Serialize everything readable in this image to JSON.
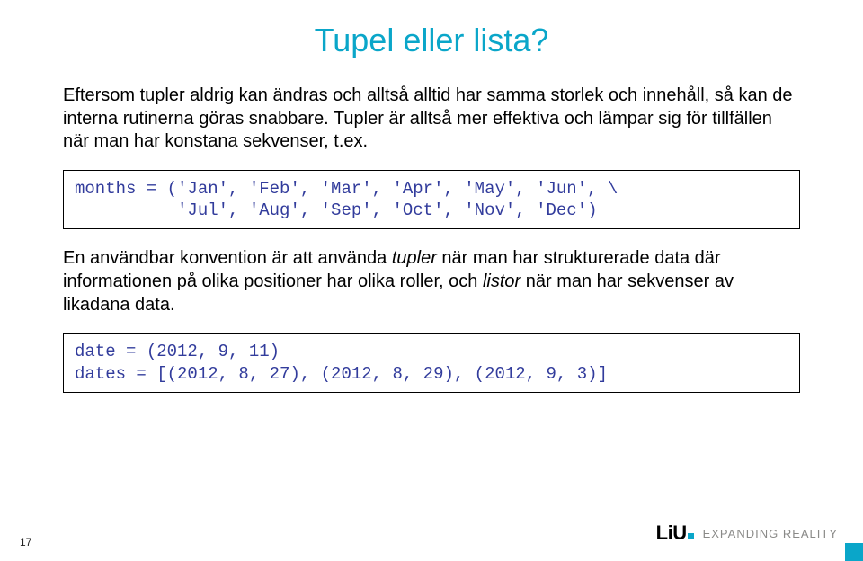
{
  "title": "Tupel eller lista?",
  "para1": "Eftersom tupler aldrig kan ändras och alltså alltid har samma storlek och innehåll, så kan de interna rutinerna göras snabbare. Tupler är alltså mer effektiva och lämpar sig för tillfällen när man har konstana sekvenser, t.ex.",
  "code1": "months = ('Jan', 'Feb', 'Mar', 'Apr', 'May', 'Jun', \\\n          'Jul', 'Aug', 'Sep', 'Oct', 'Nov', 'Dec')",
  "para2_a": "En användbar konvention är att använda ",
  "para2_tupler": "tupler",
  "para2_b": " när man har strukturerade data där informationen på olika positioner har olika roller, och ",
  "para2_listor": "listor",
  "para2_c": " när man har sekvenser av likadana data.",
  "code2": "date = (2012, 9, 11)\ndates = [(2012, 8, 27), (2012, 8, 29), (2012, 9, 3)]",
  "pagenum": "17",
  "brand_logo": "LiU",
  "brand_tag": "EXPANDING REALITY"
}
